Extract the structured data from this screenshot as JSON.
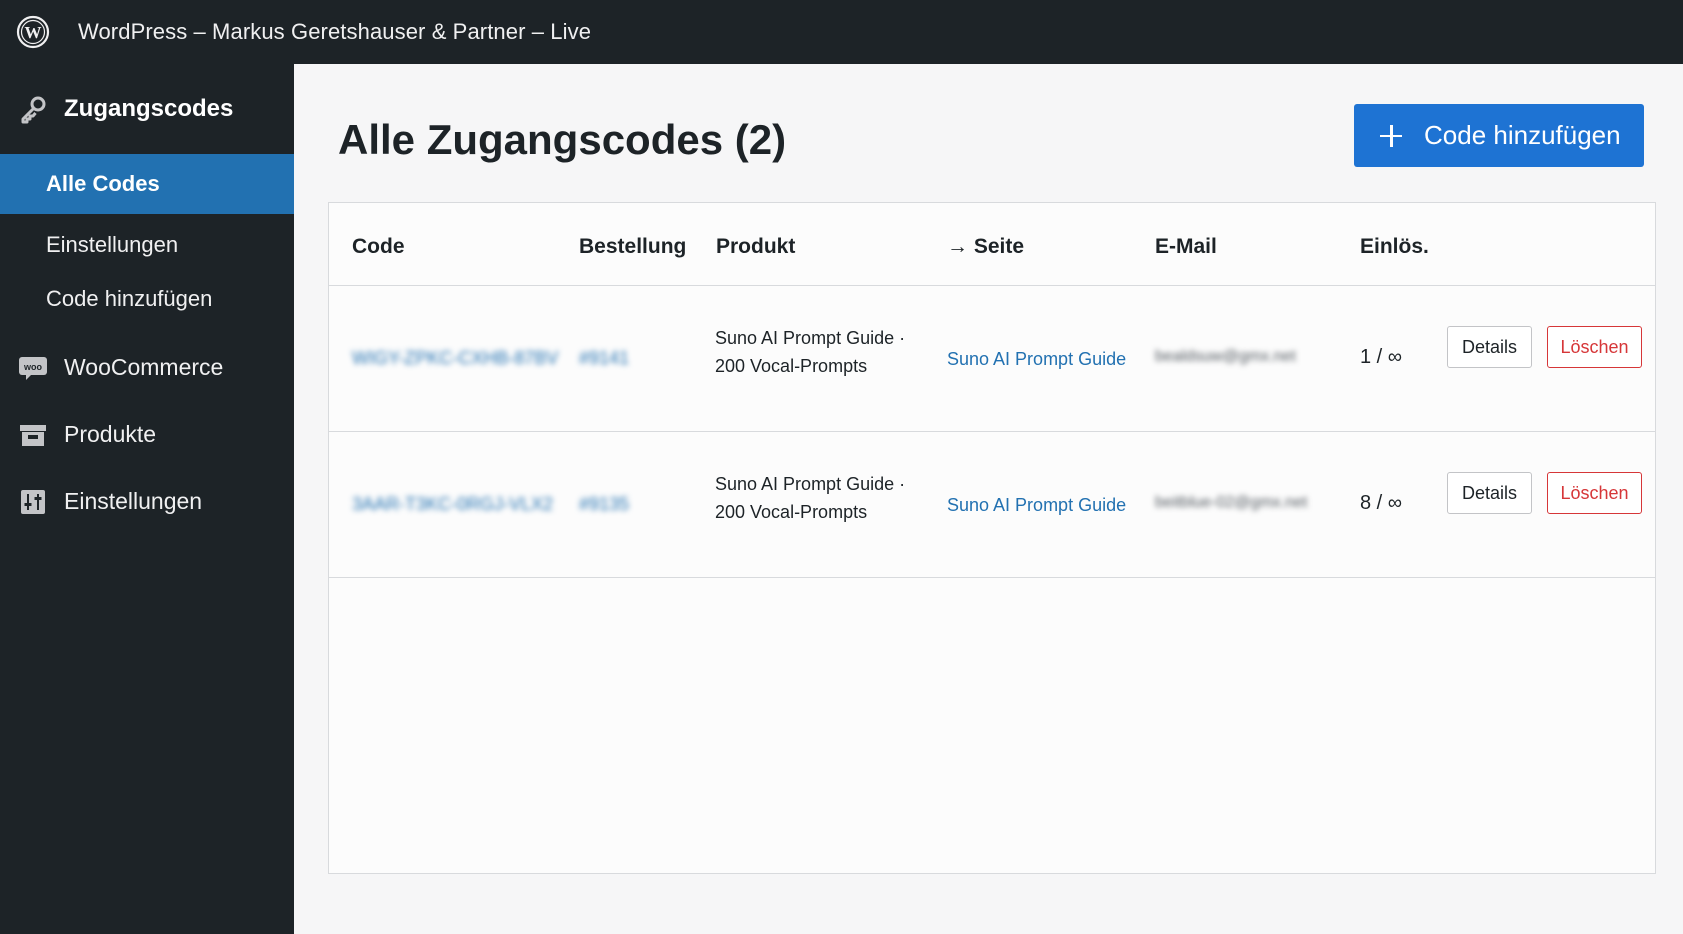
{
  "topbar": {
    "site_title": "WordPress – Markus Geretshauser & Partner – Live",
    "logo_icon": "wordpress-logo-icon"
  },
  "sidebar": {
    "section_title": "Zugangscodes",
    "section_icon": "key-icon",
    "subitems": [
      {
        "label": "Alle Codes",
        "active": true
      },
      {
        "label": "Einstellungen",
        "active": false
      },
      {
        "label": "Code hinzufügen",
        "active": false
      }
    ],
    "menu": [
      {
        "label": "WooCommerce",
        "icon": "woocommerce-icon"
      },
      {
        "label": "Produkte",
        "icon": "archive-box-icon"
      },
      {
        "label": "Einstellungen",
        "icon": "settings-sliders-icon"
      }
    ],
    "colors": {
      "background": "#1d2327",
      "active": "#2271b1"
    }
  },
  "main": {
    "title": "Alle Zugangscodes (2)",
    "add_button_label": "Code hinzufügen",
    "table": {
      "headers": {
        "code": "Code",
        "order": "Bestellung",
        "product": "Produkt",
        "page": "→ Seite",
        "email": "E-Mail",
        "redemptions": "Einlös."
      },
      "rows": [
        {
          "code": "WIGY-ZPKC-CXHB-87BV",
          "order": "#9141",
          "product_line1": "Suno AI Prompt Guide ·",
          "product_line2": "200 Vocal-Prompts",
          "page": "Suno AI Prompt Guide",
          "email": "bealdsuw@gmx.net",
          "redemptions": "1 / ∞",
          "details_label": "Details",
          "delete_label": "Löschen"
        },
        {
          "code": "3AAR-T3KC-0RGJ-VLX2",
          "order": "#9135",
          "product_line1": "Suno AI Prompt Guide ·",
          "product_line2": "200 Vocal-Prompts",
          "page": "Suno AI Prompt Guide",
          "email": "beitblue-02@gmx.net",
          "redemptions": "8 / ∞",
          "details_label": "Details",
          "delete_label": "Löschen"
        }
      ]
    },
    "colors": {
      "primary": "#1e73d3",
      "link": "#2271b1",
      "danger": "#d63638"
    }
  }
}
